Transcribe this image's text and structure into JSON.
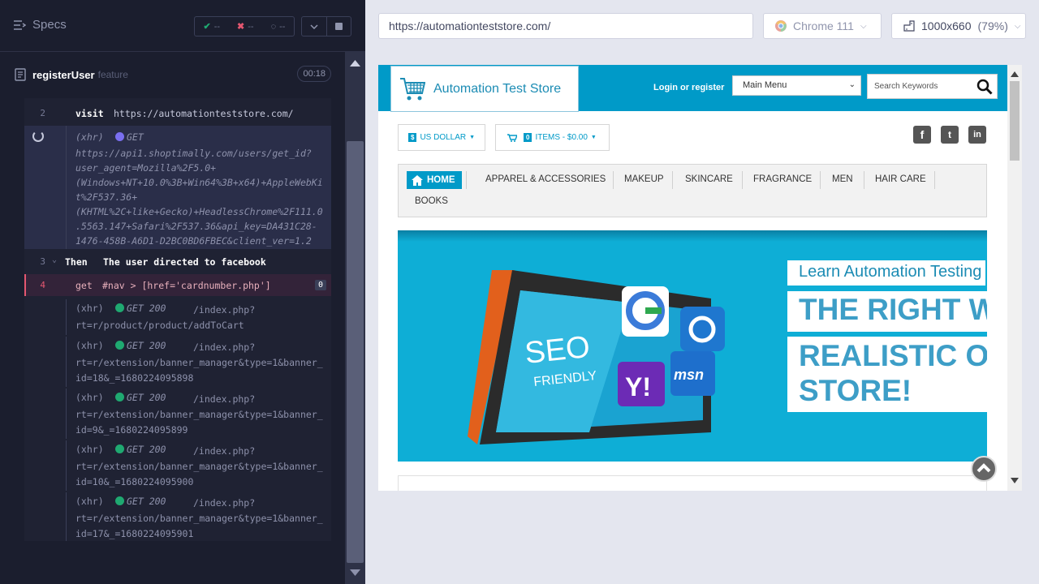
{
  "runner": {
    "specs_label": "Specs",
    "stats": {
      "passed": "--",
      "failed": "--",
      "pending": "--"
    },
    "spec_name": "registerUser",
    "spec_tag": "feature",
    "spec_time": "00:18",
    "commands": [
      {
        "line": "2",
        "name": "visit",
        "message": "https://automationteststore.com/"
      },
      {
        "type": "(xhr)",
        "method": "GET",
        "message": "https://api1.shoptimally.com/users/get_id?\nuser_agent=Mozilla%2F5.0+\n(Windows+NT+10.0%3B+Win64%3B+x64)+AppleWebKi\nt%2F537.36+\n(KHTML%2C+like+Gecko)+HeadlessChrome%2F111.0\n.5563.147+Safari%2F537.36&api_key=DA431C28-\n1476-458B-A6D1-D2BC0BD6FBEC&client_ver=1.2"
      },
      {
        "line": "3",
        "name": "Then",
        "message": "The user directed to facebook"
      },
      {
        "line": "4",
        "name": "get",
        "message": "#nav > [href='cardnumber.php']",
        "count": "0"
      },
      {
        "type": "(xhr)",
        "method": "GET 200",
        "message": "/index.php?\nrt=r/product/product/addToCart"
      },
      {
        "type": "(xhr)",
        "method": "GET 200",
        "message": "/index.php?\nrt=r/extension/banner_manager&type=1&banner_\nid=18&_=1680224095898"
      },
      {
        "type": "(xhr)",
        "method": "GET 200",
        "message": "/index.php?\nrt=r/extension/banner_manager&type=1&banner_\nid=9&_=1680224095899"
      },
      {
        "type": "(xhr)",
        "method": "GET 200",
        "message": "/index.php?\nrt=r/extension/banner_manager&type=1&banner_\nid=10&_=1680224095900"
      },
      {
        "type": "(xhr)",
        "method": "GET 200",
        "message": "/index.php?\nrt=r/extension/banner_manager&type=1&banner_\nid=17&_=1680224095901"
      }
    ]
  },
  "aut": {
    "url": "https://automationteststore.com/",
    "browser": "Chrome 111",
    "viewport": "1000x660",
    "zoom": "(79%)"
  },
  "site": {
    "logo_text": "Automation Test Store",
    "login": "Login or register",
    "main_menu": "Main Menu",
    "search_placeholder": "Search Keywords",
    "currency": "US DOLLAR",
    "cart_count": "0",
    "cart_label": "ITEMS - $0.00",
    "nav": {
      "home": "HOME",
      "items": [
        "APPAREL & ACCESSORIES",
        "MAKEUP",
        "SKINCARE",
        "FRAGRANCE",
        "MEN",
        "HAIR CARE",
        "BOOKS"
      ]
    },
    "banner": {
      "learn": "Learn Automation Testing",
      "headline1": "THE RIGHT W",
      "headline2": "REALISTIC O\nSTORE!",
      "screen_text1": "SEO",
      "screen_text2": "FRIENDLY"
    }
  },
  "colors": {
    "accent": "#009ac8",
    "pass": "#1fa971",
    "fail": "#e45770",
    "runner_bg": "#1b1e2e"
  }
}
